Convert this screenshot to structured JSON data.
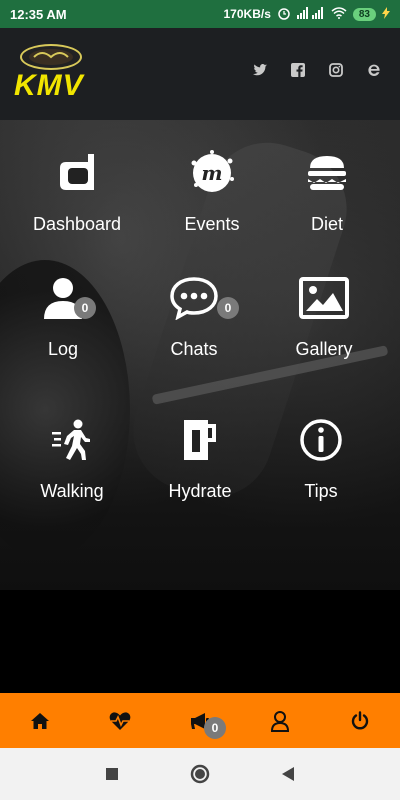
{
  "status": {
    "time": "12:35 AM",
    "speed": "170KB/s",
    "battery": "83"
  },
  "header": {
    "logo_text": "KMV",
    "social": [
      "twitter-icon",
      "facebook-icon",
      "instagram-icon",
      "web-icon"
    ]
  },
  "tiles": [
    {
      "label": "Dashboard",
      "icon": "dashboard-icon"
    },
    {
      "label": "Events",
      "icon": "events-icon"
    },
    {
      "label": "Diet",
      "icon": "burger-icon"
    },
    {
      "label": "Log",
      "icon": "user-icon",
      "count": "0"
    },
    {
      "label": "Chats",
      "icon": "chat-icon",
      "count": "0"
    },
    {
      "label": "Gallery",
      "icon": "image-icon"
    },
    {
      "label": "Walking",
      "icon": "walking-icon"
    },
    {
      "label": "Hydrate",
      "icon": "mug-icon"
    },
    {
      "label": "Tips",
      "icon": "info-icon"
    }
  ],
  "bottom_nav": {
    "items": [
      "home-icon",
      "heart-rate-icon",
      "megaphone-icon",
      "profile-icon",
      "power-icon"
    ],
    "megaphone_count": "0"
  },
  "colors": {
    "accent": "#ff7f00",
    "status_bar": "#1f6f3f",
    "logo_yellow": "#f1e500"
  }
}
